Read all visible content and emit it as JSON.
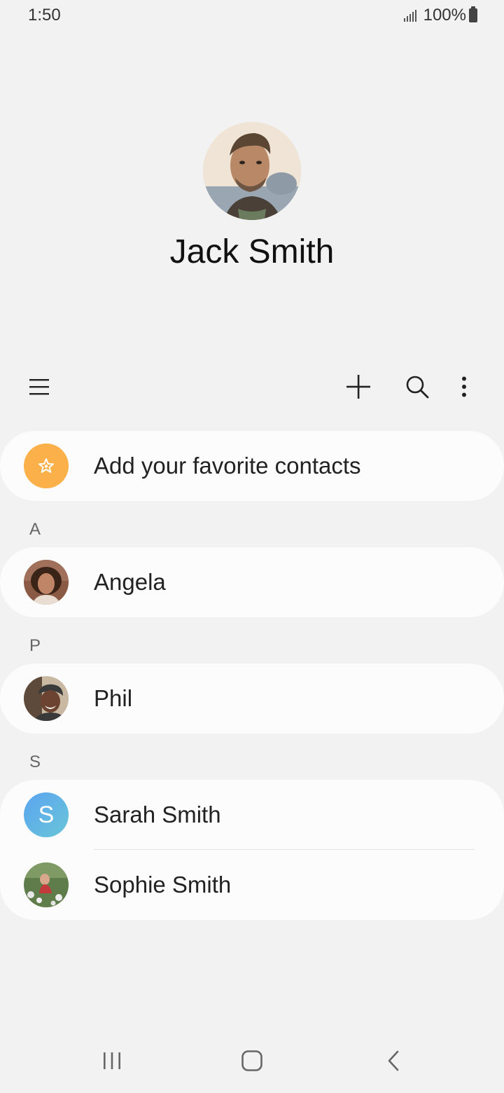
{
  "status": {
    "time": "1:50",
    "battery": "100%"
  },
  "profile": {
    "name": "Jack Smith"
  },
  "favorites": {
    "label": "Add your favorite contacts"
  },
  "sections": [
    {
      "letter": "A",
      "contacts": [
        {
          "name": "Angela"
        }
      ]
    },
    {
      "letter": "P",
      "contacts": [
        {
          "name": "Phil"
        }
      ]
    },
    {
      "letter": "S",
      "contacts": [
        {
          "name": "Sarah Smith",
          "initial": "S"
        },
        {
          "name": "Sophie Smith"
        }
      ]
    }
  ],
  "icons": {
    "menu": "menu-icon",
    "add": "plus-icon",
    "search": "search-icon",
    "more": "more-vert-icon",
    "recents": "recents-icon",
    "home": "home-icon",
    "back": "back-icon",
    "favorite": "star-icon"
  },
  "colors": {
    "favorite_accent": "#fbb04a",
    "letter_avatar": "#5aa4f0"
  }
}
